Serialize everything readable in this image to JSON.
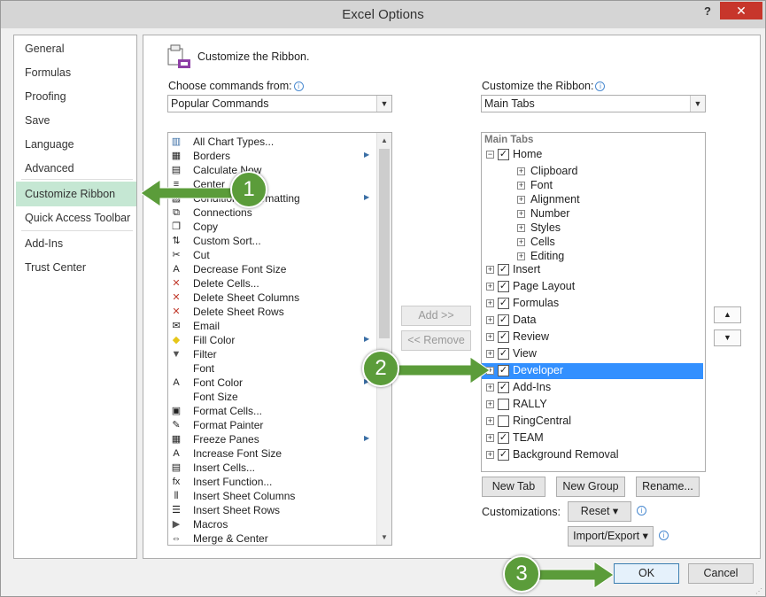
{
  "window": {
    "title": "Excel Options",
    "help_glyph": "?",
    "close_glyph": "✕"
  },
  "nav": {
    "items": [
      "General",
      "Formulas",
      "Proofing",
      "Save",
      "Language",
      "Advanced",
      "Customize Ribbon",
      "Quick Access Toolbar",
      "Add-Ins",
      "Trust Center"
    ],
    "selected": "Customize Ribbon"
  },
  "header": {
    "title": "Customize the Ribbon."
  },
  "left_panel": {
    "label": "Choose commands from:",
    "combo_value": "Popular Commands",
    "commands": [
      {
        "label": "All Chart Types...",
        "icon": "chart-icon",
        "submenu": false
      },
      {
        "label": "Borders",
        "icon": "borders-icon",
        "submenu": true
      },
      {
        "label": "Calculate Now",
        "icon": "calculator-icon",
        "submenu": false
      },
      {
        "label": "Center",
        "icon": "center-align-icon",
        "submenu": false
      },
      {
        "label": "Conditional Formatting",
        "icon": "conditional-formatting-icon",
        "submenu": true
      },
      {
        "label": "Connections",
        "icon": "connections-icon",
        "submenu": false
      },
      {
        "label": "Copy",
        "icon": "copy-icon",
        "submenu": false
      },
      {
        "label": "Custom Sort...",
        "icon": "sort-icon",
        "submenu": false
      },
      {
        "label": "Cut",
        "icon": "scissors-icon",
        "submenu": false
      },
      {
        "label": "Decrease Font Size",
        "icon": "decrease-font-icon",
        "submenu": false
      },
      {
        "label": "Delete Cells...",
        "icon": "delete-cells-icon",
        "submenu": false
      },
      {
        "label": "Delete Sheet Columns",
        "icon": "delete-columns-icon",
        "submenu": false
      },
      {
        "label": "Delete Sheet Rows",
        "icon": "delete-rows-icon",
        "submenu": false
      },
      {
        "label": "Email",
        "icon": "email-icon",
        "submenu": false
      },
      {
        "label": "Fill Color",
        "icon": "fill-color-icon",
        "submenu": true
      },
      {
        "label": "Filter",
        "icon": "filter-icon",
        "submenu": false
      },
      {
        "label": "Font",
        "icon": "font-icon",
        "submenu": false
      },
      {
        "label": "Font Color",
        "icon": "font-color-icon",
        "submenu": true
      },
      {
        "label": "Font Size",
        "icon": "font-size-icon",
        "submenu": false
      },
      {
        "label": "Format Cells...",
        "icon": "format-cells-icon",
        "submenu": false
      },
      {
        "label": "Format Painter",
        "icon": "format-painter-icon",
        "submenu": false
      },
      {
        "label": "Freeze Panes",
        "icon": "freeze-panes-icon",
        "submenu": true
      },
      {
        "label": "Increase Font Size",
        "icon": "increase-font-icon",
        "submenu": false
      },
      {
        "label": "Insert Cells...",
        "icon": "insert-cells-icon",
        "submenu": false
      },
      {
        "label": "Insert Function...",
        "icon": "function-icon",
        "submenu": false
      },
      {
        "label": "Insert Sheet Columns",
        "icon": "insert-columns-icon",
        "submenu": false
      },
      {
        "label": "Insert Sheet Rows",
        "icon": "insert-rows-icon",
        "submenu": false
      },
      {
        "label": "Macros",
        "icon": "macros-icon",
        "submenu": false
      },
      {
        "label": "Merge & Center",
        "icon": "merge-center-icon",
        "submenu": false
      }
    ]
  },
  "middle": {
    "add_label": "Add >>",
    "remove_label": "<< Remove"
  },
  "right_panel": {
    "label": "Customize the Ribbon:",
    "combo_value": "Main Tabs",
    "group_header": "Main Tabs",
    "home": {
      "label": "Home",
      "checked": true,
      "expanded": true,
      "children": [
        "Clipboard",
        "Font",
        "Alignment",
        "Number",
        "Styles",
        "Cells",
        "Editing"
      ]
    },
    "tabs": [
      {
        "label": "Insert",
        "checked": true,
        "selected": false
      },
      {
        "label": "Page Layout",
        "checked": true,
        "selected": false
      },
      {
        "label": "Formulas",
        "checked": true,
        "selected": false
      },
      {
        "label": "Data",
        "checked": true,
        "selected": false
      },
      {
        "label": "Review",
        "checked": true,
        "selected": false
      },
      {
        "label": "View",
        "checked": true,
        "selected": false
      },
      {
        "label": "Developer",
        "checked": true,
        "selected": true
      },
      {
        "label": "Add-Ins",
        "checked": true,
        "selected": false
      },
      {
        "label": "RALLY",
        "checked": false,
        "selected": false
      },
      {
        "label": "RingCentral",
        "checked": false,
        "selected": false
      },
      {
        "label": "TEAM",
        "checked": true,
        "selected": false
      },
      {
        "label": "Background Removal",
        "checked": true,
        "selected": false
      }
    ],
    "new_tab_label": "New Tab",
    "new_group_label": "New Group",
    "rename_label": "Rename...",
    "customizations_label": "Customizations:",
    "reset_label": "Reset ▾",
    "import_export_label": "Import/Export ▾"
  },
  "footer": {
    "ok_label": "OK",
    "cancel_label": "Cancel"
  },
  "callouts": [
    "1",
    "2",
    "3"
  ],
  "colors": {
    "selected_nav": "#c5e7d3",
    "selection_blue": "#3390ff",
    "callout_green": "#5b9c3a",
    "close_red": "#c7362b"
  }
}
